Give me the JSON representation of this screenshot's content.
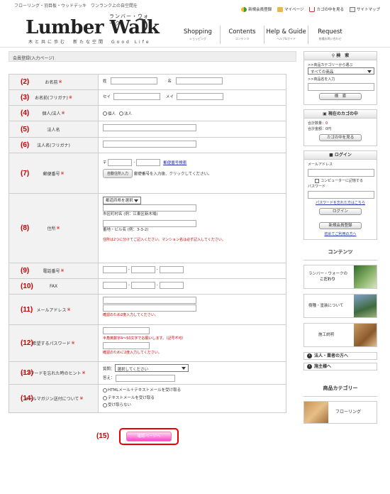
{
  "header": {
    "tagline": "フローリング・羽目板・ウッドデッキ　ワンランク上の自空間を",
    "links": [
      "新規会員登録",
      "マイページ",
      "カゴの中を見る",
      "サイトマップ"
    ],
    "logo": {
      "sub": "ランバー・ウォーク",
      "main": "Lumber Walk",
      "motto": "木と共に歩む　新たな空間　Good Life"
    },
    "nav": [
      {
        "label": "Shopping",
        "sub": "ショッピング"
      },
      {
        "label": "Contents",
        "sub": "コンテンツ"
      },
      {
        "label": "Help & Guide",
        "sub": "ヘルプ&ガイド"
      },
      {
        "label": "Request",
        "sub": "各種お問い合わせ"
      }
    ]
  },
  "page_title": "会員登録(入力ページ)",
  "form": {
    "required_mark": "※",
    "rows": [
      {
        "num": "(2)",
        "label": "お名前"
      },
      {
        "num": "(3)",
        "label": "お名前(フリガナ)"
      },
      {
        "num": "(4)",
        "label": "個人/法人"
      },
      {
        "num": "(5)",
        "label": "法人名"
      },
      {
        "num": "(6)",
        "label": "法人名(フリガナ)"
      },
      {
        "num": "(7)",
        "label": "郵便番号"
      },
      {
        "num": "(8)",
        "label": "住所"
      },
      {
        "num": "(9)",
        "label": "電話番号"
      },
      {
        "num": "(10)",
        "label": "FAX"
      },
      {
        "num": "(11)",
        "label": "メールアドレス"
      },
      {
        "num": "(12)",
        "label": "希望するパスワード"
      },
      {
        "num": "(13)",
        "label": "パスワードを忘れた時のヒント"
      },
      {
        "num": "(14)",
        "label": "メールマガジン送付について"
      }
    ],
    "name_sei": "姓",
    "name_mei": "名",
    "kana_sei": "セイ",
    "kana_mei": "メイ",
    "personal": "個人",
    "corporate": "法人",
    "zip_prefix": "〒",
    "zip_dash": "-",
    "zip_link": "郵便番号検索",
    "auto_addr_btn": "自動住所入力",
    "zip_hint": "郵便番号を入力後、クリックしてください。",
    "pref_select": "都道府県を選択",
    "addr1_hint": "市区町村名 (例：江東区新木場)",
    "addr2_hint": "番地・ビル名 (例：3-3-2)",
    "addr_note": "住所は2つに分けてご記入ください。マンション名は必ず記入してください。",
    "tel_dash": "-",
    "email_note": "確認のため2度入力してください。",
    "pw_note": "半角英数字4～50文字でお願いします。（記号不可）",
    "pw_confirm_note": "確認のために2度入力してください。",
    "hint_q_label": "質問：",
    "hint_q_value": "選択してください",
    "hint_a_label": "答え：",
    "mail_options": [
      "HTMLメール＋テキストメールを受け取る",
      "テキストメールを受け取る",
      "受け取らない"
    ],
    "submit_num": "(15)",
    "submit_label": "確認ページへ"
  },
  "sidebar": {
    "search": {
      "title": "検　索",
      "cat_label": ">>商品カテゴリーから選ぶ",
      "cat_value": "すべての商品",
      "name_label": ">>商品名を入力",
      "button": "検　索"
    },
    "cart": {
      "title": "現在のカゴの中",
      "count_label": "合計数量：",
      "count_value": "0",
      "total_label": "合計金額：",
      "total_value": "0円",
      "button": "カゴの中を見る"
    },
    "login": {
      "title": "ログイン",
      "email_label": "メールアドレス",
      "remember": "コンピューターに記憶する",
      "pw_label": "パスワード",
      "forgot": "パスワードを忘れた方はこちら",
      "button": "ログイン",
      "register": "新規会員登録",
      "first": "初めてご利用の方へ"
    },
    "contents_title": "コンテンツ",
    "contents": [
      {
        "label": "ランバー・ウォークの",
        "label2": "こだわり"
      },
      {
        "label": "樹種・塗装について",
        "label2": ""
      },
      {
        "label": "施工説明",
        "label2": ""
      }
    ],
    "bars": [
      "法人・業者の方へ",
      "施主様へ"
    ],
    "cat_title": "商品カテゴリー",
    "cat_item": "フローリング"
  }
}
